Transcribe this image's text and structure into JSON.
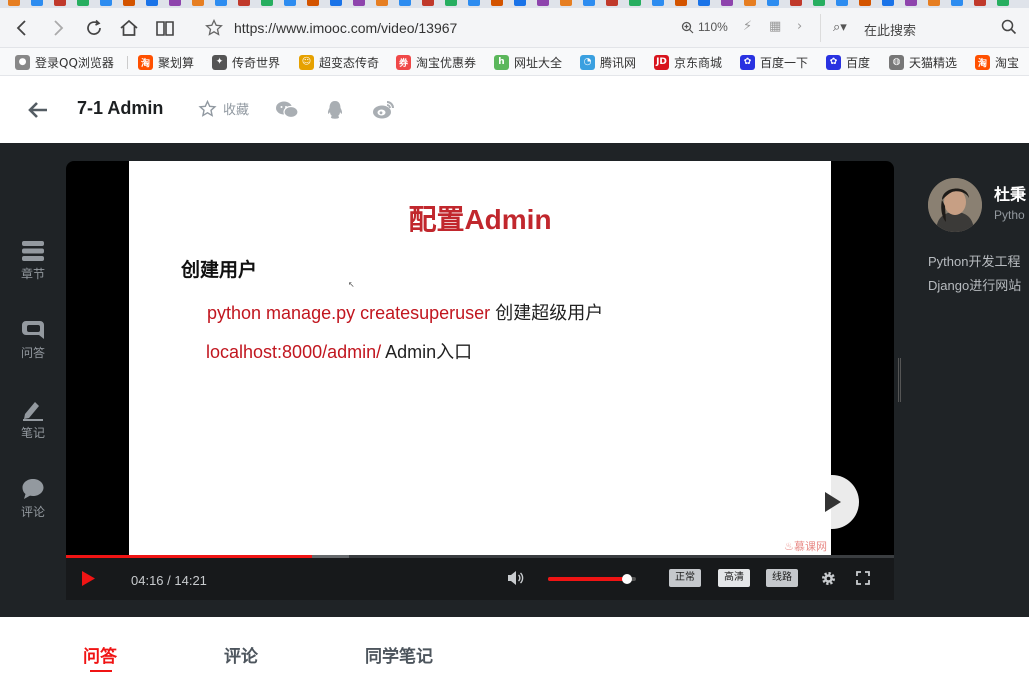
{
  "browser": {
    "url": "https://www.imooc.com/video/13967",
    "zoom": "110%",
    "search_placeholder": "在此搜索",
    "bookmarks": [
      {
        "label": "登录QQ浏览器",
        "icon": "user-icon",
        "color": "#888888"
      },
      {
        "label": "聚划算",
        "icon": "taobao-icon",
        "color": "#ff5000"
      },
      {
        "label": "传奇世界",
        "icon": "game-icon",
        "color": "#555555"
      },
      {
        "label": "超变态传奇",
        "icon": "smile-icon",
        "color": "#e6a100"
      },
      {
        "label": "淘宝优惠券",
        "icon": "coupon-icon",
        "color": "#f04848"
      },
      {
        "label": "网址大全",
        "icon": "hao-icon",
        "color": "#5bb75b"
      },
      {
        "label": "腾讯网",
        "icon": "tencent-icon",
        "color": "#3aa0e0"
      },
      {
        "label": "京东商城",
        "icon": "jd-icon",
        "color": "#d8141d"
      },
      {
        "label": "百度一下",
        "icon": "baidu-icon",
        "color": "#2932e1"
      },
      {
        "label": "百度",
        "icon": "baidu-icon",
        "color": "#2932e1"
      },
      {
        "label": "天猫精选",
        "icon": "globe-icon",
        "color": "#777777"
      },
      {
        "label": "淘宝",
        "icon": "taobao-icon",
        "color": "#ff5000"
      }
    ]
  },
  "header": {
    "title": "7-1 Admin",
    "favorite_label": "收藏"
  },
  "sidebar": {
    "items": [
      {
        "label": "章节",
        "icon": "chapters-icon"
      },
      {
        "label": "问答",
        "icon": "qa-icon"
      },
      {
        "label": "笔记",
        "icon": "note-icon"
      },
      {
        "label": "评论",
        "icon": "comment-icon"
      }
    ]
  },
  "slide": {
    "title": "配置Admin",
    "heading": "创建用户",
    "line1_code": "python manage.py createsuperuser",
    "line1_text": "创建超级用户",
    "line2_code": "localhost:8000/admin/",
    "line2_text": "Admin入口",
    "watermark": "慕课网"
  },
  "player": {
    "current_time": "04:16",
    "duration": "14:21",
    "time_display": "04:16 / 14:21",
    "progress_fraction": 0.2974,
    "buffered_fraction": 0.342,
    "volume_fraction": 0.9,
    "quality_options": [
      "正常",
      "高清",
      "线路"
    ],
    "selected_quality": "高清",
    "colors": {
      "accent": "#f01414"
    }
  },
  "teacher": {
    "name": "杜秉",
    "job": "Pytho",
    "desc_line1": "Python开发工程",
    "desc_line2": "Django进行网站"
  },
  "tabs": [
    {
      "label": "问答",
      "active": true
    },
    {
      "label": "评论",
      "active": false
    },
    {
      "label": "同学笔记",
      "active": false
    }
  ]
}
